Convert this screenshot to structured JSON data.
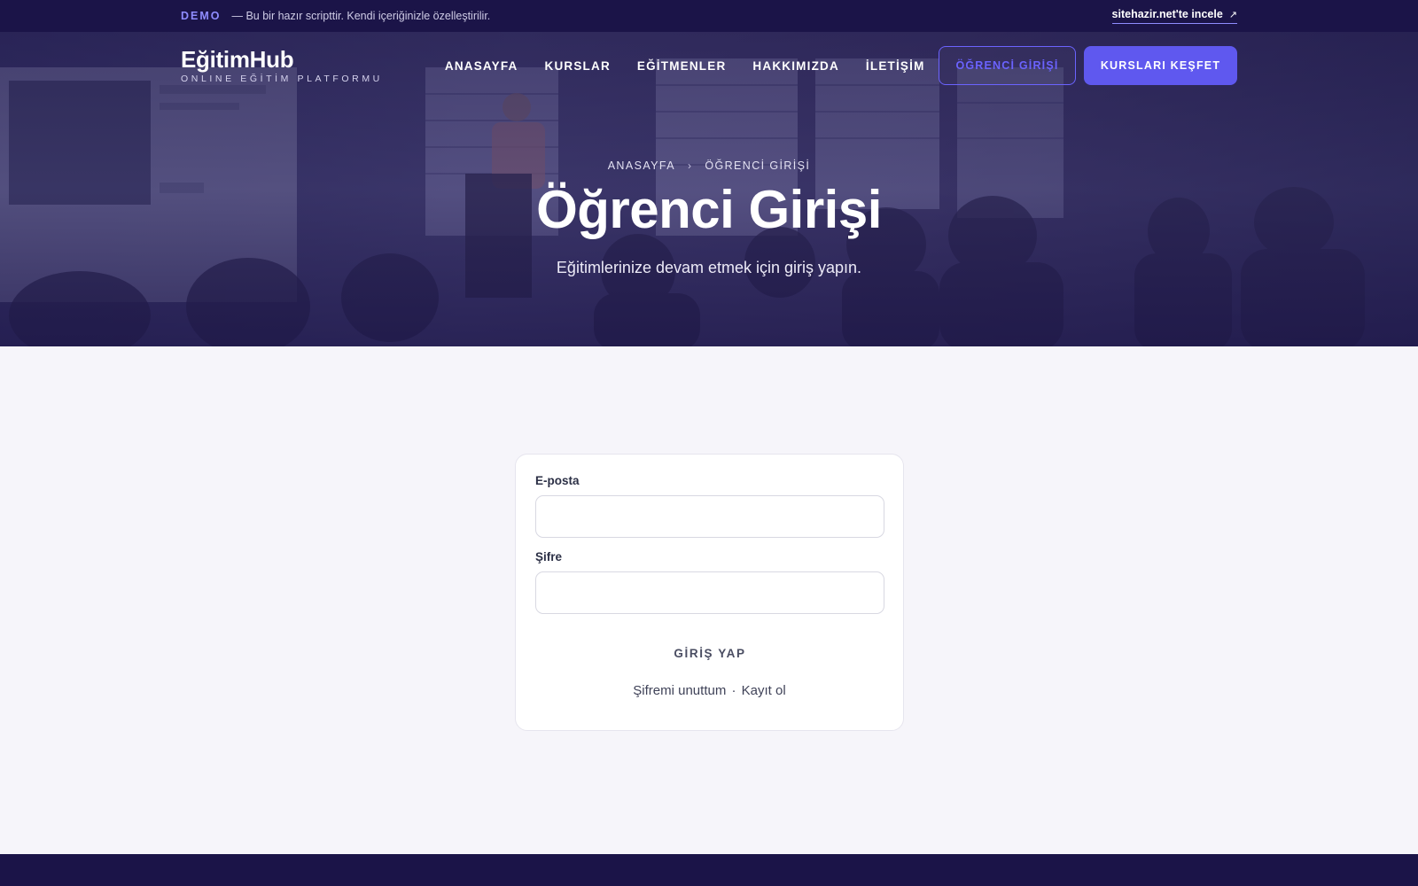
{
  "demo_bar": {
    "tag": "DEMO",
    "text": "— Bu bir hazır scripttir. Kendi içeriğinizle özelleştirilir.",
    "link_label": "sitehazir.net'te incele",
    "link_icon": "arrow-up-right-icon"
  },
  "header": {
    "brand_name": "EğitimHub",
    "brand_tagline": "ONLINE EĞİTİM PLATFORMU",
    "nav": [
      "ANASAYFA",
      "KURSLAR",
      "EĞİTMENLER",
      "HAKKIMIZDA",
      "İLETİŞİM"
    ],
    "login_button": "ÖĞRENCİ GİRİŞİ",
    "cta_button": "KURSLARI KEŞFET"
  },
  "hero": {
    "breadcrumb_home": "ANASAYFA",
    "breadcrumb_current": "ÖĞRENCİ GİRİŞİ",
    "title": "Öğrenci Girişi",
    "subtitle": "Eğitimlerinize devam etmek için giriş yapın."
  },
  "login_form": {
    "email_label": "E-posta",
    "email_value": "",
    "password_label": "Şifre",
    "password_value": "",
    "submit_label": "GİRİŞ YAP",
    "forgot_link": "Şifremi unuttum",
    "separator": "·",
    "register_link": "Kayıt ol"
  },
  "colors": {
    "dark_navy": "#1b1448",
    "accent": "#5f58ef",
    "demo_tag": "#8f8cff",
    "page_background": "#f6f5fa",
    "card_background": "#ffffff"
  }
}
